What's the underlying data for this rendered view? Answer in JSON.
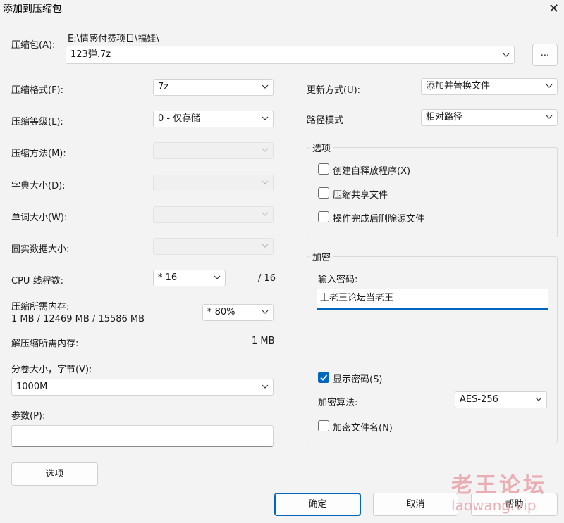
{
  "window": {
    "title": "添加到压缩包",
    "close_glyph": "✕"
  },
  "archive": {
    "label": "压缩包(A):",
    "path": "E:\\情感付费项目\\福娃\\",
    "filename": "123弹.7z",
    "browse_label": "..."
  },
  "left": {
    "format": {
      "label": "压缩格式(F):",
      "value": "7z"
    },
    "level": {
      "label": "压缩等级(L):",
      "value": "0 - 仅存储"
    },
    "method": {
      "label": "压缩方法(M):",
      "value": ""
    },
    "dict": {
      "label": "字典大小(D):",
      "value": ""
    },
    "word": {
      "label": "单词大小(W):",
      "value": ""
    },
    "solid": {
      "label": "固实数据大小:",
      "value": ""
    },
    "threads": {
      "label": "CPU 线程数:",
      "value": "* 16",
      "max": "/ 16"
    },
    "memory": {
      "label": "压缩所需内存:",
      "detail": "1 MB / 12469 MB / 15586 MB",
      "value": "* 80%"
    },
    "decomp": {
      "label": "解压缩所需内存:",
      "value": "1 MB"
    },
    "volume": {
      "label": "分卷大小，字节(V):",
      "value": "1000M"
    },
    "params": {
      "label": "参数(P):",
      "value": ""
    },
    "options_button": "选项"
  },
  "right": {
    "update": {
      "label": "更新方式(U):",
      "value": "添加并替换文件"
    },
    "pathmode": {
      "label": "路径模式",
      "value": "相对路径"
    },
    "options_group": {
      "title": "选项",
      "items": [
        {
          "label": "创建自释放程序(X)",
          "checked": false
        },
        {
          "label": "压缩共享文件",
          "checked": false
        },
        {
          "label": "操作完成后删除源文件",
          "checked": false
        }
      ]
    },
    "encryption": {
      "title": "加密",
      "password_label": "输入密码:",
      "password_value": "上老王论坛当老王",
      "show_password": {
        "label": "显示密码(S)",
        "checked": true
      },
      "method_label": "加密算法:",
      "method_value": "AES-256",
      "encrypt_names": {
        "label": "加密文件名(N)",
        "checked": false
      }
    }
  },
  "buttons": {
    "ok": "确定",
    "cancel": "取消",
    "help": "帮助"
  },
  "watermark": {
    "line1": "老王论坛",
    "line2": "laowang.vip"
  },
  "colors": {
    "accent": "#0067c0",
    "background": "#f3f3f3"
  }
}
